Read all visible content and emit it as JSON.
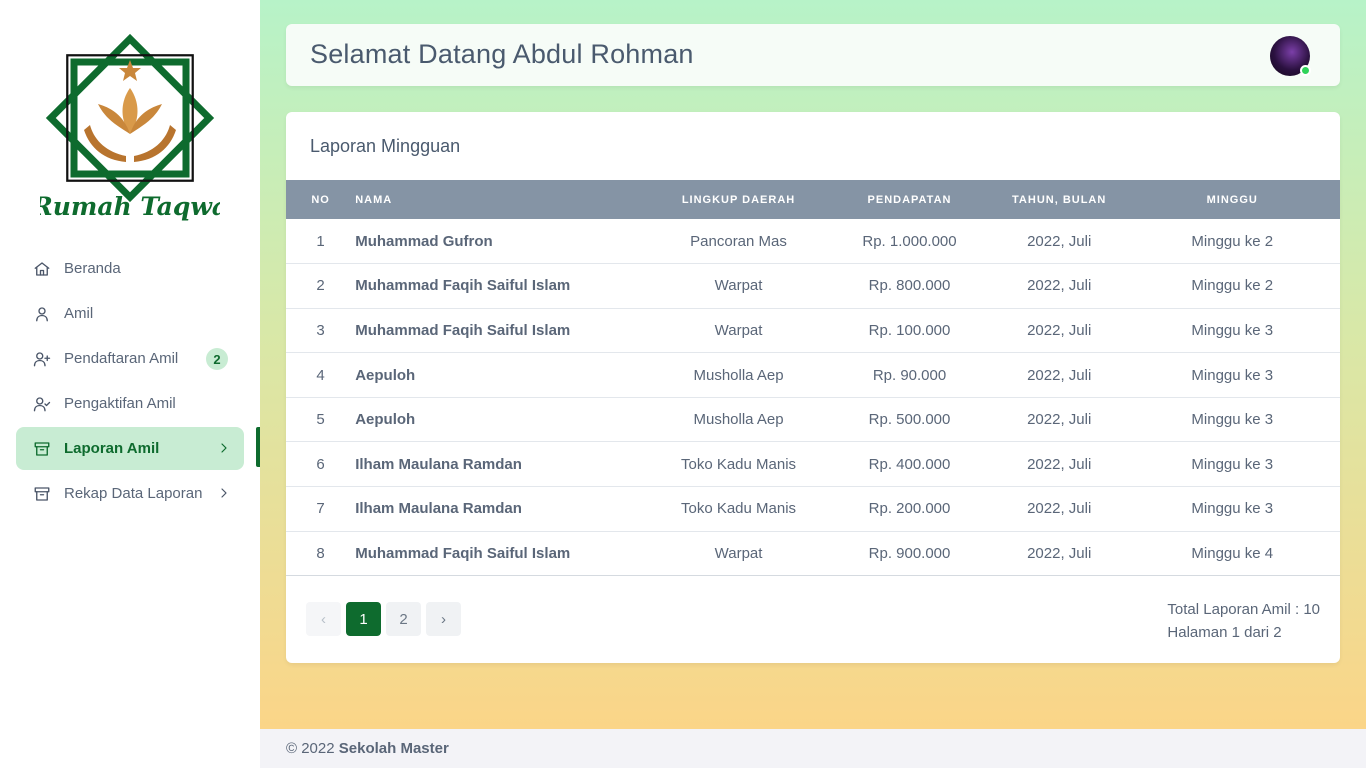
{
  "brand": {
    "logo_text": "Rumah Taqwa",
    "colors": {
      "green": "#0e6b2e",
      "gold": "#c9873b",
      "light_green": "#c8ecd3"
    }
  },
  "sidebar": {
    "items": [
      {
        "label": "Beranda",
        "icon": "home-icon"
      },
      {
        "label": "Amil",
        "icon": "user-icon"
      },
      {
        "label": "Pendaftaran Amil",
        "icon": "user-plus-icon",
        "badge": "2"
      },
      {
        "label": "Pengaktifan Amil",
        "icon": "user-check-icon"
      },
      {
        "label": "Laporan Amil",
        "icon": "archive-icon",
        "active": true,
        "chevron": true
      },
      {
        "label": "Rekap Data Laporan",
        "icon": "archive-icon",
        "chevron": true
      }
    ]
  },
  "header": {
    "title": "Selamat Datang Abdul Rohman",
    "avatar": "user-avatar",
    "online": true
  },
  "report": {
    "title": "Laporan Mingguan",
    "columns": [
      "NO",
      "NAMA",
      "LINGKUP DAERAH",
      "PENDAPATAN",
      "TAHUN, BULAN",
      "MINGGU"
    ],
    "rows": [
      [
        "1",
        "Muhammad Gufron",
        "Pancoran Mas",
        "Rp. 1.000.000",
        "2022, Juli",
        "Minggu ke 2"
      ],
      [
        "2",
        "Muhammad Faqih Saiful Islam",
        "Warpat",
        "Rp. 800.000",
        "2022, Juli",
        "Minggu ke 2"
      ],
      [
        "3",
        "Muhammad Faqih Saiful Islam",
        "Warpat",
        "Rp. 100.000",
        "2022, Juli",
        "Minggu ke 3"
      ],
      [
        "4",
        "Aepuloh",
        "Musholla Aep",
        "Rp. 90.000",
        "2022, Juli",
        "Minggu ke 3"
      ],
      [
        "5",
        "Aepuloh",
        "Musholla Aep",
        "Rp. 500.000",
        "2022, Juli",
        "Minggu ke 3"
      ],
      [
        "6",
        "Ilham Maulana Ramdan",
        "Toko Kadu Manis",
        "Rp. 400.000",
        "2022, Juli",
        "Minggu ke 3"
      ],
      [
        "7",
        "Ilham Maulana Ramdan",
        "Toko Kadu Manis",
        "Rp. 200.000",
        "2022, Juli",
        "Minggu ke 3"
      ],
      [
        "8",
        "Muhammad Faqih Saiful Islam",
        "Warpat",
        "Rp. 900.000",
        "2022, Juli",
        "Minggu ke 4"
      ]
    ],
    "pagination": {
      "prev": "‹",
      "pages": [
        "1",
        "2"
      ],
      "current": "1",
      "next": "›"
    },
    "total_text": "Total Laporan Amil : 10",
    "page_text": "Halaman 1 dari 2"
  },
  "footer": {
    "copyright": "© 2022",
    "org": "Sekolah Master"
  }
}
